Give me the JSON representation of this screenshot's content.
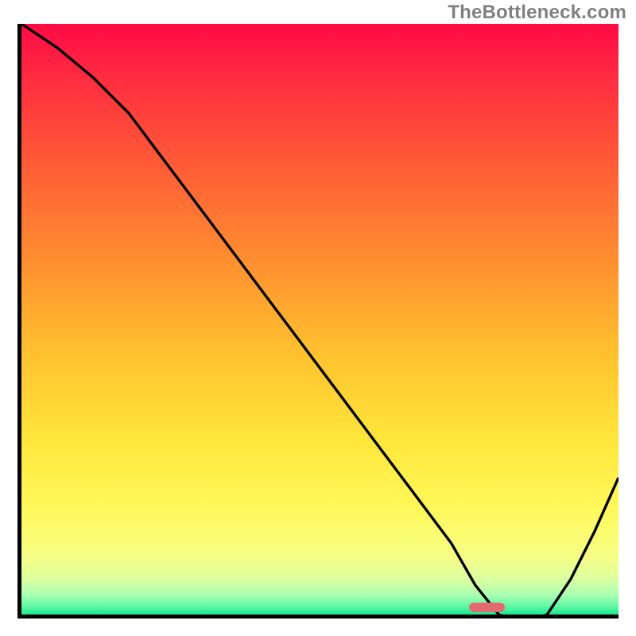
{
  "watermark": "TheBottleneck.com",
  "chart_data": {
    "type": "line",
    "title": "",
    "xlabel": "",
    "ylabel": "",
    "xlim": [
      0,
      100
    ],
    "ylim": [
      0,
      100
    ],
    "x": [
      0,
      6,
      12,
      18,
      24,
      30,
      36,
      42,
      48,
      54,
      60,
      66,
      72,
      76,
      80,
      84,
      88,
      92,
      96,
      100
    ],
    "values": [
      100,
      96,
      91,
      85,
      77,
      69,
      61,
      53,
      45,
      37,
      29,
      21,
      13,
      6,
      1,
      0,
      1,
      7,
      15,
      24
    ],
    "gradient_stops": [
      {
        "pos": 0.0,
        "color": "#ff0a44"
      },
      {
        "pos": 0.1,
        "color": "#ff2f3f"
      },
      {
        "pos": 0.25,
        "color": "#ff5f35"
      },
      {
        "pos": 0.4,
        "color": "#ff8e2f"
      },
      {
        "pos": 0.55,
        "color": "#ffbf2e"
      },
      {
        "pos": 0.7,
        "color": "#ffe539"
      },
      {
        "pos": 0.82,
        "color": "#fff95a"
      },
      {
        "pos": 0.9,
        "color": "#f7ff83"
      },
      {
        "pos": 0.94,
        "color": "#dcffa0"
      },
      {
        "pos": 0.965,
        "color": "#aeffb0"
      },
      {
        "pos": 0.985,
        "color": "#66f9a6"
      },
      {
        "pos": 1.0,
        "color": "#19e88f"
      }
    ],
    "marker": {
      "x_center": 78,
      "y": 1.2,
      "width_pct": 6,
      "height_pct": 1.6,
      "color": "#e46a70"
    }
  }
}
